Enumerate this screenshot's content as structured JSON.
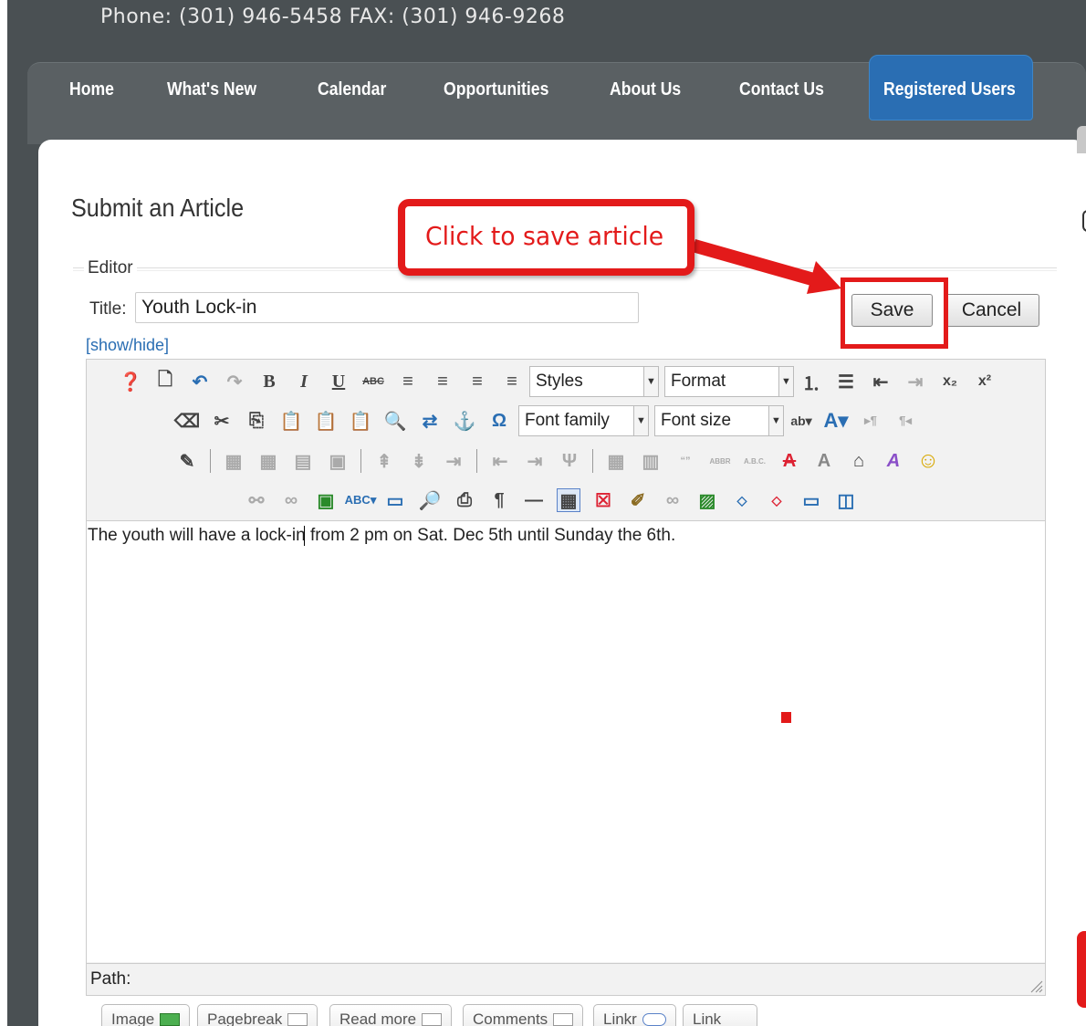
{
  "header": {
    "phone_text": "Phone: (301) 946-5458 FAX: (301) 946-9268"
  },
  "nav": {
    "items": [
      {
        "label": "Home"
      },
      {
        "label": "What's New"
      },
      {
        "label": "Calendar"
      },
      {
        "label": "Opportunities"
      },
      {
        "label": "About Us"
      },
      {
        "label": "Contact Us"
      }
    ],
    "active": {
      "label": "Registered Users"
    }
  },
  "page": {
    "title": "Submit an Article",
    "legend": "Editor",
    "title_label": "Title:",
    "title_value": "Youth Lock-in",
    "show_hide": "[show/hide]",
    "save_label": "Save",
    "cancel_label": "Cancel"
  },
  "callout": {
    "text": "Click to save article"
  },
  "toolbar": {
    "styles": "Styles",
    "format": "Format",
    "font_family": "Font family",
    "font_size": "Font size",
    "symbols": {
      "bold": "B",
      "italic": "I",
      "underline": "U",
      "omega": "Ω",
      "pilcrow": "¶",
      "hr": "—",
      "subscript": "x₂",
      "superscript": "x²"
    }
  },
  "editor": {
    "content": "The youth will have a lock-in from 2 pm on Sat. Dec 5th until Sunday the 6th.",
    "path_label": "Path:"
  },
  "bottom_buttons": [
    {
      "label": "Image"
    },
    {
      "label": "Pagebreak"
    },
    {
      "label": "Read more"
    },
    {
      "label": "Comments"
    },
    {
      "label": "Linkr"
    },
    {
      "label": "Link"
    }
  ],
  "colors": {
    "accent": "#e31a1a",
    "nav_active": "#2a6eb3",
    "frame": "#4a5053"
  }
}
